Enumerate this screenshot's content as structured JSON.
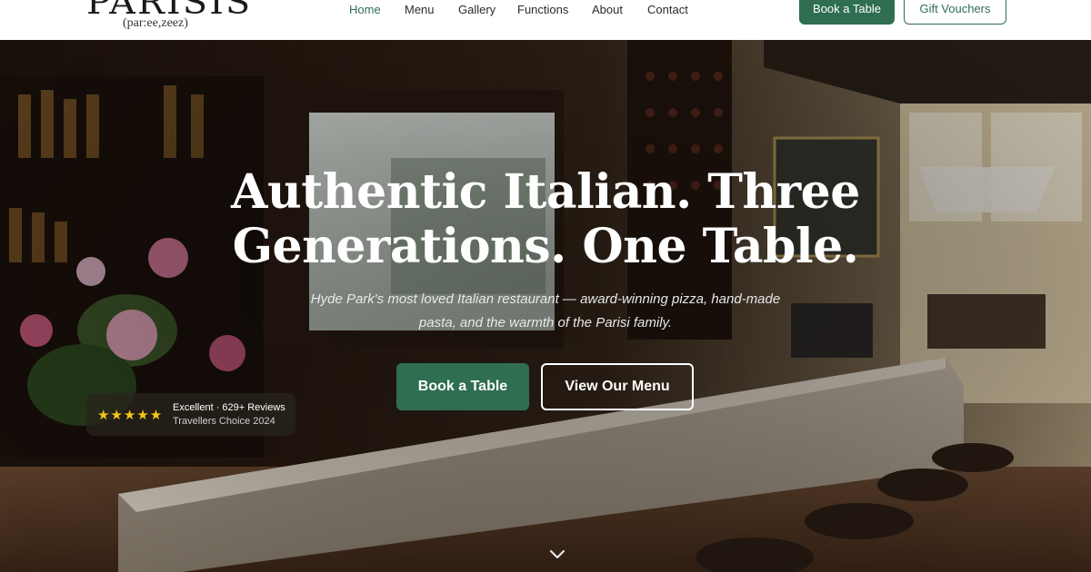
{
  "logo": {
    "wordmark": "PARISIS",
    "pronunciation": "(par:ee,zeez)"
  },
  "nav": {
    "items": [
      "Home",
      "Menu",
      "Gallery",
      "Functions",
      "About",
      "Contact"
    ],
    "active": "Home"
  },
  "header_buttons": {
    "book": "Book a Table",
    "gift": "Gift Vouchers"
  },
  "hero": {
    "headline_line1": "Authentic Italian. Three",
    "headline_line2": "Generations. One Table.",
    "subtext_line1": "Hyde Park's most loved Italian restaurant — award-winning pizza, hand-made",
    "subtext_line2": "pasta, and the warmth of the Parisi family.",
    "primary_button": "Book a Table",
    "secondary_button": "View Our Menu"
  },
  "review_badge": {
    "stars": "★★★★★",
    "rating_count": 5,
    "title": "Excellent · 629+ Reviews",
    "subtitle": "Travellers Choice 2024"
  },
  "colors": {
    "brand_green": "#2f6e51",
    "star_gold": "#f5c518",
    "header_bg": "#ffffff"
  },
  "icons": {
    "scroll": "chevron-down-icon"
  }
}
